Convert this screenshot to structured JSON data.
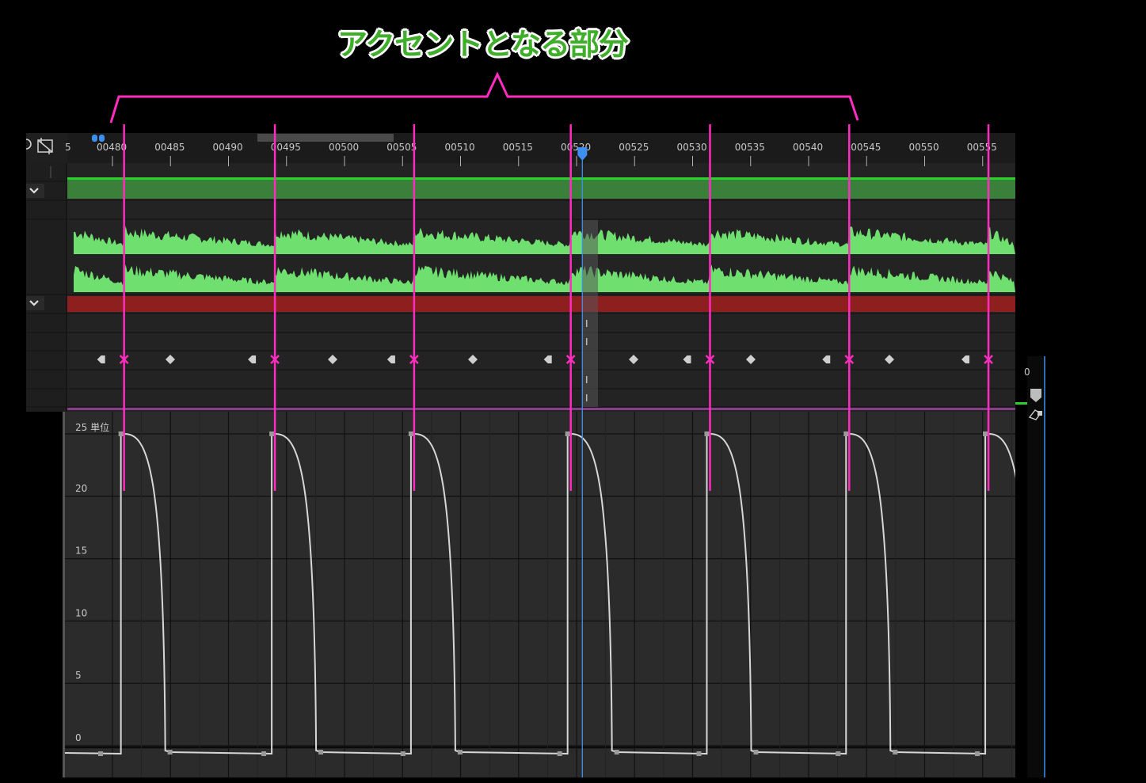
{
  "annotation": {
    "title": "アクセントとなる部分"
  },
  "timeline": {
    "ruler_ticks": [
      "00480",
      "00485",
      "00490",
      "00495",
      "00500",
      "00505",
      "00510",
      "00515",
      "00520",
      "00525",
      "00530",
      "00535",
      "00540",
      "00545",
      "00550",
      "00555"
    ],
    "playhead_frame": 520.5,
    "video_track_color": "#3a7f3a",
    "audio_waveform_color": "#6fe06f",
    "adjust_track_color": "#8e1f1f",
    "accent_marker_color": "#ff2cc0",
    "playhead_color": "#3d8ff0"
  },
  "graph": {
    "unit_label": "25 単位",
    "y_ticks": [
      "0",
      "5",
      "10",
      "15",
      "20"
    ],
    "y_range": [
      0,
      25
    ],
    "accent_frames": [
      481,
      494,
      506,
      519.5,
      531.5,
      543.5,
      555.5
    ]
  },
  "icons": {
    "header_left": "keyframe-nav-icon",
    "header_clip": "clip-crop-icon",
    "collapse": "chevron-down-icon",
    "right_marker": "marker-icon",
    "right_tool": "pen-tool-icon"
  }
}
